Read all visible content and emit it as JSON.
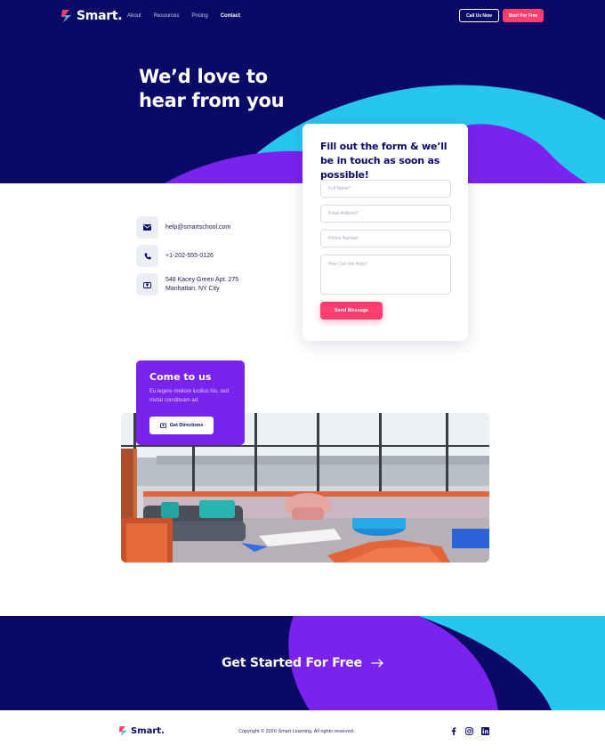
{
  "brand": {
    "name": "Smart."
  },
  "nav": {
    "links": [
      "About",
      "Resources",
      "Pricing",
      "Contact"
    ],
    "active": "Contact",
    "call_button": "Call Us Now",
    "start_button": "Start For Free"
  },
  "hero": {
    "title_line1": "We’d love to",
    "title_line2": "hear from you"
  },
  "contact": {
    "email": "help@smartschool.com",
    "phone": "+1-202-555-0126",
    "address_line1": "548 Kacey Green Apt. 275",
    "address_line2": "Manhattan, NY City"
  },
  "form": {
    "title": "Fill out the form & we’ll be in touch as soon as possible!",
    "full_name_placeholder": "Full Name*",
    "email_placeholder": "Email Address*",
    "phone_placeholder": "Phone Number",
    "message_placeholder": "How Can We Help?",
    "submit_label": "Send Message"
  },
  "location": {
    "title": "Come to us",
    "description": "Eu legere meliore lucilius his, sed mutat constituam ad.",
    "directions_button": "Get Directions"
  },
  "cta": {
    "label": "Get Started For Free"
  },
  "footer": {
    "brand": "Smart.",
    "copyright": "Copyright © 2020 Smart Learning. All rights reserved.",
    "social_icons": [
      "facebook-icon",
      "instagram-icon",
      "linkedin-icon"
    ]
  },
  "colors": {
    "navy": "#0a0a66",
    "cyan": "#27c6f0",
    "purple": "#7a22ee",
    "pink": "#ff3d6e"
  }
}
